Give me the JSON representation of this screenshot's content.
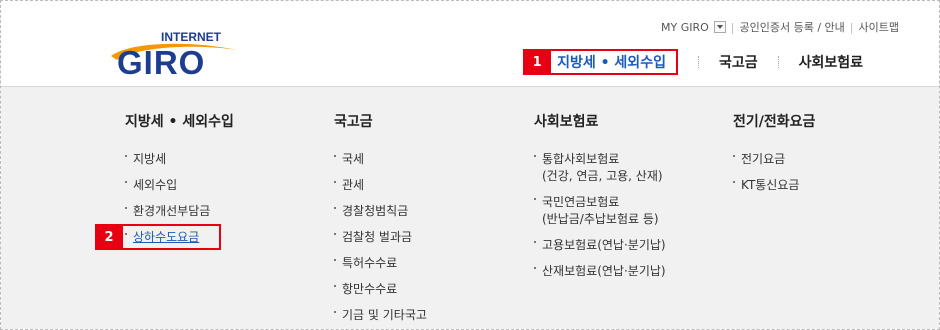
{
  "logo": {
    "top": "INTERNET",
    "main": "GIRO"
  },
  "util": {
    "my_giro": "MY GIRO",
    "cert": "공인인증서 등록 / 안내",
    "sitemap": "사이트맵"
  },
  "gnb": {
    "badge": "1",
    "items": [
      "지방세 • 세외수입",
      "국고금",
      "사회보험료"
    ]
  },
  "mega": {
    "col1": {
      "title": "지방세 • 세외수입",
      "items": [
        "지방세",
        "세외수입",
        "환경개선부담금",
        "상하수도요금"
      ],
      "highlight_badge": "2"
    },
    "col2": {
      "title": "국고금",
      "items": [
        "국세",
        "관세",
        "경찰청범칙금",
        "검찰청 벌과금",
        "특허수수료",
        "항만수수료",
        "기금 및 기타국고"
      ]
    },
    "col3": {
      "title": "사회보험료",
      "items": [
        {
          "line1": "통합사회보험료",
          "line2": "(건강, 연금, 고용, 산재)"
        },
        {
          "line1": "국민연금보험료",
          "line2": "(반납금/추납보험료 등)"
        },
        {
          "line1": "고용보험료(연납·분기납)",
          "line2": ""
        },
        {
          "line1": "산재보험료(연납·분기납)",
          "line2": ""
        }
      ]
    },
    "col4": {
      "title": "전기/전화요금",
      "items": [
        "전기요금",
        "KT통신요금"
      ]
    }
  },
  "colors": {
    "brand_blue": "#1a5ab8",
    "logo_navy": "#1d3d8f",
    "logo_orange": "#f39800",
    "highlight_red": "#e60012",
    "menu_bg": "#f1f1f1"
  }
}
